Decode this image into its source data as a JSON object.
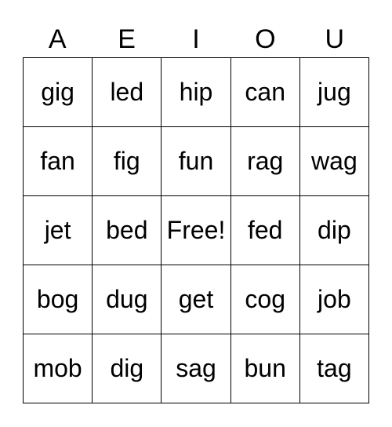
{
  "header": [
    "A",
    "E",
    "I",
    "O",
    "U"
  ],
  "cells": [
    [
      "gig",
      "led",
      "hip",
      "can",
      "jug"
    ],
    [
      "fan",
      "fig",
      "fun",
      "rag",
      "wag"
    ],
    [
      "jet",
      "bed",
      "Free!",
      "fed",
      "dip"
    ],
    [
      "bog",
      "dug",
      "get",
      "cog",
      "job"
    ],
    [
      "mob",
      "dig",
      "sag",
      "bun",
      "tag"
    ]
  ]
}
